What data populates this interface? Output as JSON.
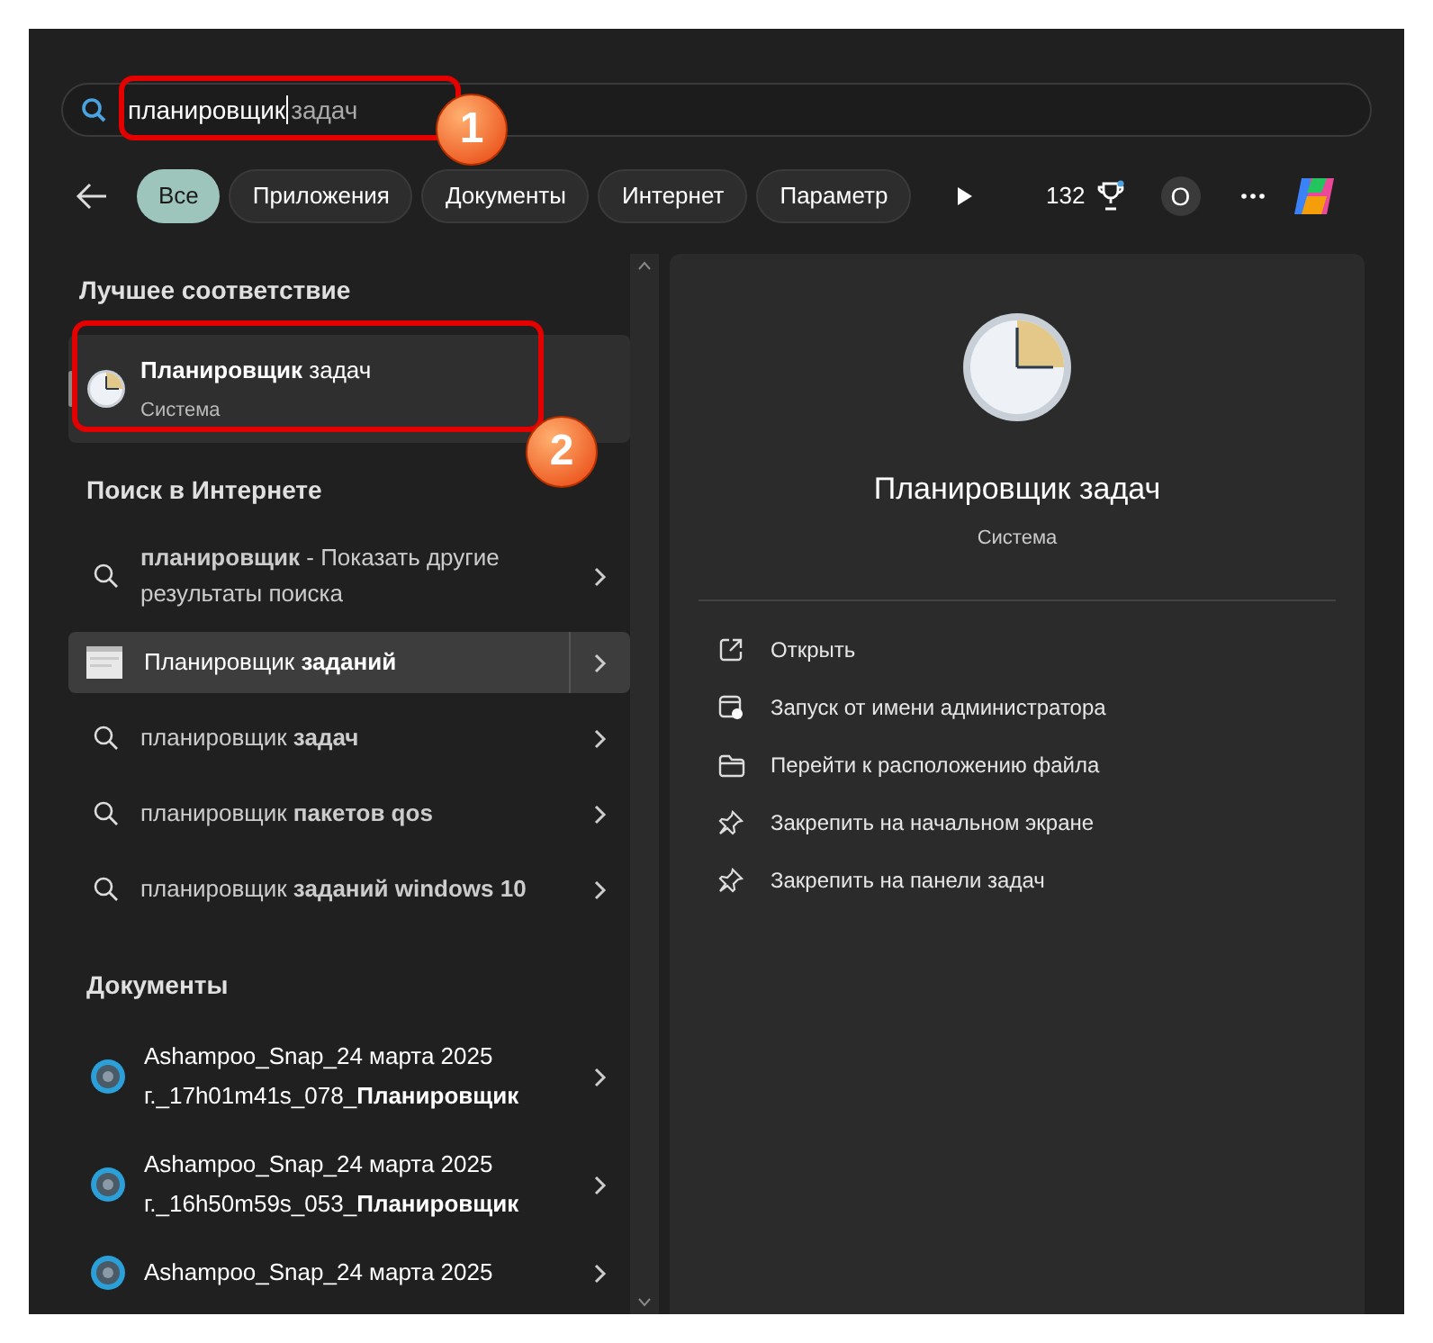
{
  "search": {
    "query": "планировщик",
    "suggestion": "задач"
  },
  "filters": [
    {
      "label": "Все",
      "selected": true
    },
    {
      "label": "Приложения",
      "selected": false
    },
    {
      "label": "Документы",
      "selected": false
    },
    {
      "label": "Интернет",
      "selected": false
    },
    {
      "label": "Параметр",
      "selected": false
    }
  ],
  "toolbar": {
    "points": "132",
    "avatar": "O"
  },
  "best_match": {
    "heading": "Лучшее соответствие",
    "title": "**Планировщик** задач",
    "subtitle": "Система",
    "selected": true
  },
  "web_search": {
    "heading": "Поиск в Интернете",
    "items": [
      {
        "kind": "search",
        "text": "**планировщик** - Показать другие результаты поиска",
        "selected": false
      },
      {
        "kind": "page",
        "text": "Планировщик **заданий**",
        "selected": true
      },
      {
        "kind": "search",
        "text": "планировщик **задач**",
        "selected": false
      },
      {
        "kind": "search",
        "text": "планировщик **пакетов qos**",
        "selected": false
      },
      {
        "kind": "search",
        "text": "планировщик **заданий windows 10**",
        "selected": false
      }
    ]
  },
  "documents": {
    "heading": "Документы",
    "items": [
      {
        "text": "Ashampoo_Snap_24 марта 2025 г._17h01m41s_078_**Планировщик**"
      },
      {
        "text": "Ashampoo_Snap_24 марта 2025 г._16h50m59s_053_**Планировщик**"
      },
      {
        "text": "Ashampoo_Snap_24 марта 2025"
      }
    ]
  },
  "detail": {
    "title": "Планировщик задач",
    "subtitle": "Система",
    "actions": [
      {
        "kind": "open",
        "label": "Открыть"
      },
      {
        "kind": "admin",
        "label": "Запуск от имени администратора"
      },
      {
        "kind": "folder",
        "label": "Перейти к расположению файла"
      },
      {
        "kind": "pin",
        "label": "Закрепить на начальном экране"
      },
      {
        "kind": "pin",
        "label": "Закрепить на панели задач"
      }
    ]
  },
  "annotations": [
    {
      "label": "1"
    },
    {
      "label": "2"
    }
  ]
}
